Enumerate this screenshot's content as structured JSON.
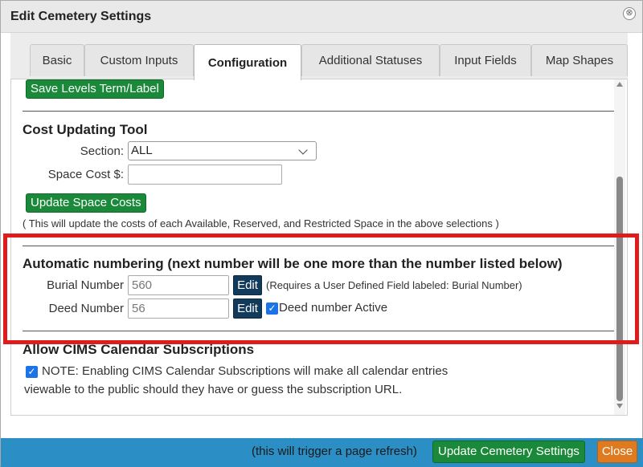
{
  "dialog": {
    "title": "Edit Cemetery Settings",
    "close_glyph": "⊗"
  },
  "tabs": [
    {
      "label": "Basic"
    },
    {
      "label": "Custom Inputs"
    },
    {
      "label": "Configuration"
    },
    {
      "label": "Additional Statuses"
    },
    {
      "label": "Input Fields"
    },
    {
      "label": "Map Shapes"
    }
  ],
  "levels": {
    "save_button": "Save Levels Term/Label"
  },
  "cost_tool": {
    "heading": "Cost Updating Tool",
    "section_label": "Section:",
    "section_value": "ALL",
    "space_cost_label": "Space Cost $:",
    "space_cost_value": "",
    "update_button": "Update Space Costs",
    "note": "( This will update the costs of each Available, Reserved, and Restricted Space in the above selections )"
  },
  "auto_numbering": {
    "heading": "Automatic numbering (next number will be one more than the number listed below)",
    "burial_label": "Burial Number",
    "burial_value": "560",
    "burial_edit": "Edit",
    "burial_note": "(Requires a User Defined Field labeled: Burial Number)",
    "deed_label": "Deed Number",
    "deed_value": "56",
    "deed_edit": "Edit",
    "deed_active_label": "Deed number Active"
  },
  "calendar": {
    "heading": "Allow CIMS Calendar Subscriptions",
    "note_line1": "NOTE: Enabling CIMS Calendar Subscriptions will make all calendar entries",
    "note_line2": "viewable to the public should they have or guess the subscription URL."
  },
  "footer": {
    "refresh_note": "(this will trigger a page refresh)",
    "update_button": "Update Cemetery Settings",
    "close_button": "Close"
  },
  "colors": {
    "accent_green": "#1a8a3a",
    "footer_blue": "#2b8ec4",
    "close_orange": "#e07a20",
    "highlight_red": "#e01b1b"
  }
}
